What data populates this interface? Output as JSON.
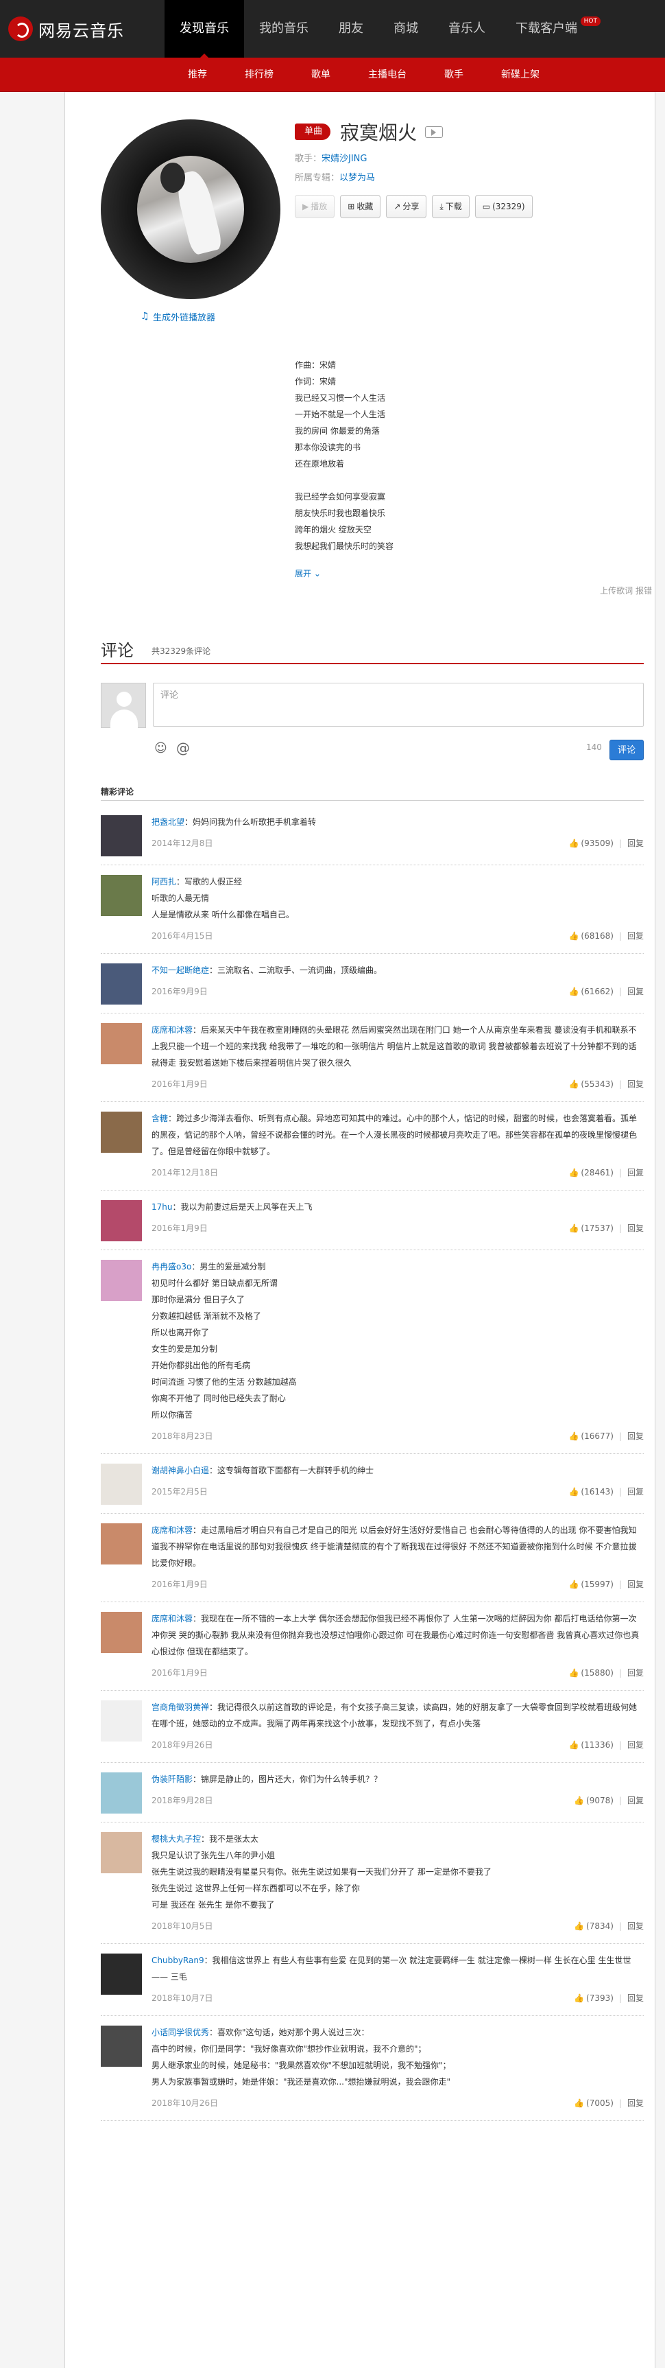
{
  "brand": {
    "name": "网易云音乐"
  },
  "nav": {
    "items": [
      {
        "label": "发现音乐"
      },
      {
        "label": "我的音乐"
      },
      {
        "label": "朋友"
      },
      {
        "label": "商城"
      },
      {
        "label": "音乐人"
      },
      {
        "label": "下载客户端"
      }
    ],
    "hot_badge": "HOT"
  },
  "subnav": {
    "items": [
      {
        "label": "推荐"
      },
      {
        "label": "排行榜"
      },
      {
        "label": "歌单"
      },
      {
        "label": "主播电台"
      },
      {
        "label": "歌手"
      },
      {
        "label": "新碟上架"
      }
    ]
  },
  "song": {
    "tag": "单曲",
    "title": "寂寞烟火",
    "singer_label": "歌手：",
    "singer": "宋婧沙JING",
    "album_label": "所属专辑：",
    "album": "以梦为马",
    "ext_link": "生成外链播放器"
  },
  "actions": {
    "play": "播放",
    "fav": "收藏",
    "share": "分享",
    "download": "下载",
    "comment": "(32329)"
  },
  "lyrics": {
    "lines": [
      "作曲：宋婧",
      "作词：宋婧",
      "我已经又习惯一个人生活",
      "一开始不就是一个人生活",
      "我的房间 你最爱的角落",
      "那本你没读完的书",
      "还在原地放着",
      "",
      "我已经学会如何享受寂寞",
      "朋友快乐时我也跟着快乐",
      "跨年的烟火 绽放天空",
      "我想起我们最快乐时的笑容"
    ],
    "expand": "展开"
  },
  "upload": "上传歌词 报错",
  "comments": {
    "title": "评论",
    "count": "共32329条评论",
    "placeholder": "评论",
    "remaining": "140",
    "send": "评论",
    "hot_title": "精彩评论",
    "reply": "回复",
    "items": [
      {
        "user": "把盏北望",
        "text": "妈妈问我为什么听歌把手机拿着转",
        "time": "2014年12月8日",
        "likes": "(93509)",
        "avatar": "#3d3a44"
      },
      {
        "user": "阿西扎",
        "text": "写歌的人假正经\n听歌的人最无情\n人是是情歌从来 听什么都像在唱自己。",
        "time": "2016年4月15日",
        "likes": "(68168)",
        "avatar": "#6a7a4a"
      },
      {
        "user": "不知一起断绝症",
        "text": "三流取名、二流取手、一流词曲，顶级编曲。",
        "time": "2016年9月9日",
        "likes": "(61662)",
        "avatar": "#4a5a7a"
      },
      {
        "user": "庞席和沐蓉",
        "text": "后来某天中午我在教室刚睡刚的头晕眼花 然后闹蜜突然出现在附门口 她一个人从南京坐车来看我 蔓读没有手机和联系不上我只能一个班一个班的来找我 给我带了一堆吃的和一张明信片 明信片上就是这首歌的歌词 我曾被都躲着去班说了十分钟都不到的话就得走 我安慰着送她下楼后来捏着明信片哭了很久很久",
        "time": "2016年1月9日",
        "likes": "(55343)",
        "avatar": "#c98a6a"
      },
      {
        "user": "含糖",
        "text": "跨过多少海洋去看你、听到有点心酸。异地恋可知其中的难过。心中的那个人，惦记的时候，甜蜜的时候，也会落寞着看。孤单的黑夜，惦记的那个人呐，曾经不说都会懂的时光。在一个人漫长黑夜的时候都被月亮吹走了吧。那些笑容都在孤单的夜晚里慢慢褪色了。但是曾经留在你眼中就够了。",
        "time": "2014年12月18日",
        "likes": "(28461)",
        "avatar": "#8a6a4a"
      },
      {
        "user": "17hu",
        "text": "我以为前妻过后是天上风筝在天上飞",
        "time": "2016年1月9日",
        "likes": "(17537)",
        "avatar": "#b44a6a"
      },
      {
        "user": "冉冉盛o3o",
        "text": "男生的爱是减分制\n初见时什么都好 第日缺点都无所谓\n那时你是满分 但日子久了\n分数越扣越低 渐渐就不及格了\n所以也离开你了\n女生的爱是加分制\n开始你都挑出他的所有毛病\n时间流逝 习惯了他的生活 分数越加越高\n你离不开他了 同时他已经失去了耐心\n所以你痛苦",
        "time": "2018年8月23日",
        "likes": "(16677)",
        "avatar": "#d8a0c8"
      },
      {
        "user": "谢胡神鼻小白遥",
        "text": "这专辑每首歌下面都有一大群转手机的绅士",
        "time": "2015年2月5日",
        "likes": "(16143)",
        "avatar": "#e8e4de"
      },
      {
        "user": "庞席和沐蓉",
        "text": "走过黑暗后才明白只有自己才是自己的阳光 以后会好好生活好好爱惜自己 也会耐心等待值得的人的出现 你不要害怕我知道我不辨罕你在电话里说的那句对我很愧疚 终于能清楚彻底的有个了断我现在过得很好 不然还不知道要被你拖到什么时候 不介意拉拔 比爱你好眼。",
        "time": "2016年1月9日",
        "likes": "(15997)",
        "avatar": "#c98a6a"
      },
      {
        "user": "庞席和沐蓉",
        "text": "我现在在一所不错的一本上大学 偶尔还会想起你但我已经不再恨你了 人生第一次喝的烂醉因为你 都后打电话给你第一次冲你哭 哭的撕心裂肺 我从来没有但你抛弃我也没想过怕哦你心跟过你 可在我最伤心难过时你连一句安慰都吝啬 我曾真心喜欢过你也真心恨过你 但现在都结束了。",
        "time": "2016年1月9日",
        "likes": "(15880)",
        "avatar": "#c98a6a"
      },
      {
        "user": "宫商角徵羽黄禅",
        "text": "我记得很久以前这首歌的评论是，有个女孩子高三复读，读高四，她的好朋友拿了一大袋零食回到学校就看班级何她在哪个班，她感动的立不成声。我隔了两年再来找这个小故事，发现找不到了，有点小失落",
        "time": "2018年9月26日",
        "likes": "(11336)",
        "avatar": "#f0f0f0"
      },
      {
        "user": "伪装阡陌影",
        "text": "锦屏是静止的，图片还大，你们为什么转手机？？",
        "time": "2018年9月28日",
        "likes": "(9078)",
        "avatar": "#9ac8d8"
      },
      {
        "user": "樱桃大丸子控",
        "text": "我不是张太太\n我只是认识了张先生八年的尹小姐\n张先生说过我的眼睛没有星星只有你。张先生说过如果有一天我们分开了 那一定是你不要我了\n张先生说过 这世界上任何一样东西都可以不在乎，除了你\n可是 我还在 张先生 是你不要我了",
        "time": "2018年10月5日",
        "likes": "(7834)",
        "avatar": "#d8b8a0"
      },
      {
        "user": "ChubbyRan9",
        "text": "我相信这世界上 有些人有些事有些爱 在见到的第一次 就注定要羁绊一生 就注定像一棵树一样 生长在心里 生生世世 —— 三毛",
        "time": "2018年10月7日",
        "likes": "(7393)",
        "avatar": "#2a2a2a"
      },
      {
        "user": "小话同学很优秀",
        "text": "喜欢你\"这句话，她对那个男人说过三次：\n高中的时候，你们是同学：\"我好像喜欢你\"想抄作业就明说，我不介意的\"；\n男人继承家业的时候，她是秘书：\"我果然喜欢你\"不想加班就明说，我不勉强你\"；\n男人为家族事暂或嫌时，她是伴娘：\"我还是喜欢你...\"想抬嫌就明说，我会跟你走\"",
        "time": "2018年10月26日",
        "likes": "(7005)",
        "avatar": "#4a4a4a"
      }
    ]
  }
}
